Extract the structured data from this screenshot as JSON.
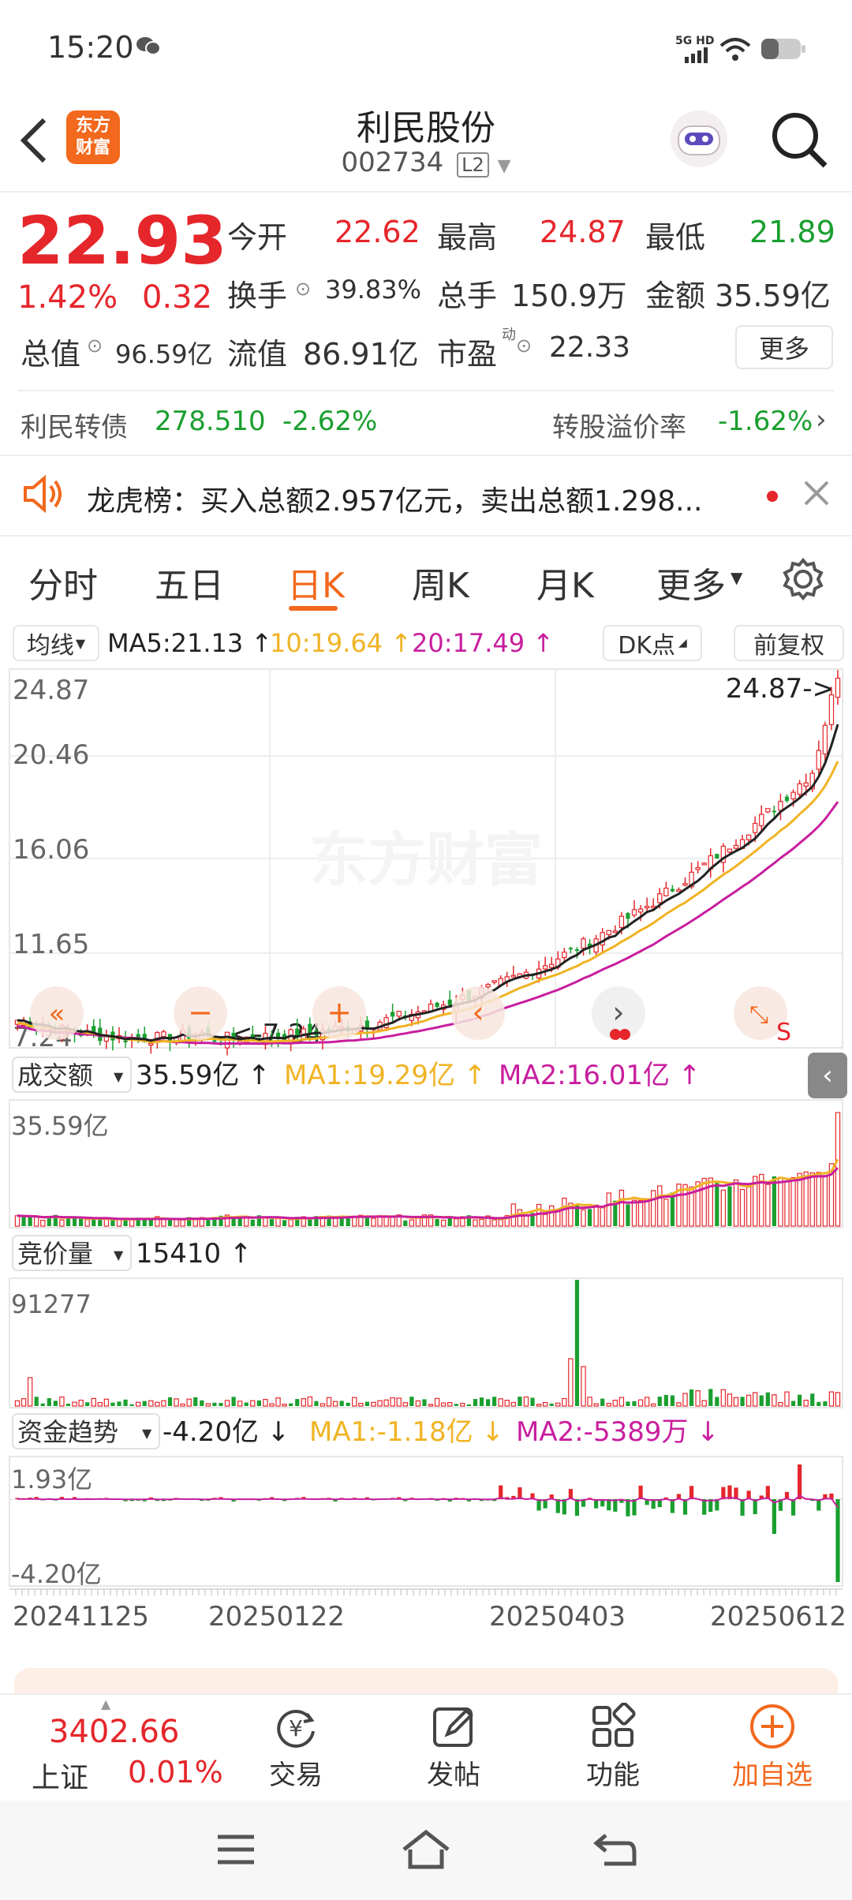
{
  "status_bar": {
    "time": "15:20",
    "network": "5G HD"
  },
  "header": {
    "title": "利民股份",
    "code": "002734",
    "level": "L2",
    "logo_text": "东方财富"
  },
  "quote": {
    "price": "22.93",
    "change_pct": "1.42%",
    "change": "0.32",
    "open_label": "今开",
    "open": "22.62",
    "high_label": "最高",
    "high": "24.87",
    "low_label": "最低",
    "low": "21.89",
    "turnover_label": "换手",
    "turnover": "39.83%",
    "volume_label": "总手",
    "volume": "150.9万",
    "amount_label": "金额",
    "amount": "35.59亿",
    "mcap_label": "总值",
    "mcap": "96.59亿",
    "float_label": "流值",
    "float": "86.91亿",
    "pe_label": "市盈",
    "pe_sup": "动",
    "pe": "22.33",
    "more_label": "更多"
  },
  "bond": {
    "name": "利民转债",
    "price": "278.510",
    "change": "-2.62%",
    "premium_label": "转股溢价率",
    "premium": "-1.62%"
  },
  "notice": {
    "text": "龙虎榜：买入总额2.957亿元，卖出总额1.298..."
  },
  "tabs": [
    "分时",
    "五日",
    "日K",
    "周K",
    "月K",
    "更多"
  ],
  "selected_tab": 2,
  "kline": {
    "indicator": "均线",
    "ma5": "MA5:21.13 ↑",
    "ma10": "10:19.64 ↑",
    "ma20": "20:17.49 ↑",
    "dk": "DK点",
    "adjust": "前复权",
    "y_ticks": [
      "24.87",
      "20.46",
      "16.06",
      "11.65",
      "7.24"
    ],
    "max_label": "24.87->",
    "min_label": "<-7.24",
    "watermark": "东方财富"
  },
  "volume_panel": {
    "name": "成交额",
    "value": "35.59亿 ↑",
    "ma1": "MA1:19.29亿 ↑",
    "ma2": "MA2:16.01亿 ↑",
    "top": "35.59亿"
  },
  "auction_panel": {
    "name": "竞价量",
    "value": "15410 ↑",
    "top": "91277"
  },
  "fund_panel": {
    "name": "资金趋势",
    "value": "-4.20亿 ↓",
    "ma1": "MA1:-1.18亿 ↓",
    "ma2": "MA2:-5389万 ↓",
    "top": "1.93亿",
    "bottom": "-4.20亿"
  },
  "x_dates": [
    "20241125",
    "20250122",
    "20250403",
    "20250612"
  ],
  "bottom_bar": {
    "index_value": "3402.66",
    "index_name": "上证",
    "index_change": "0.01%",
    "trade": "交易",
    "post": "发帖",
    "func": "功能",
    "add": "加自选"
  },
  "colors": {
    "up": "#e5262b",
    "down": "#1a9f2f",
    "accent": "#f2681c",
    "ma5": "#222222",
    "ma10": "#f0b323",
    "ma20": "#c81e9e"
  }
}
